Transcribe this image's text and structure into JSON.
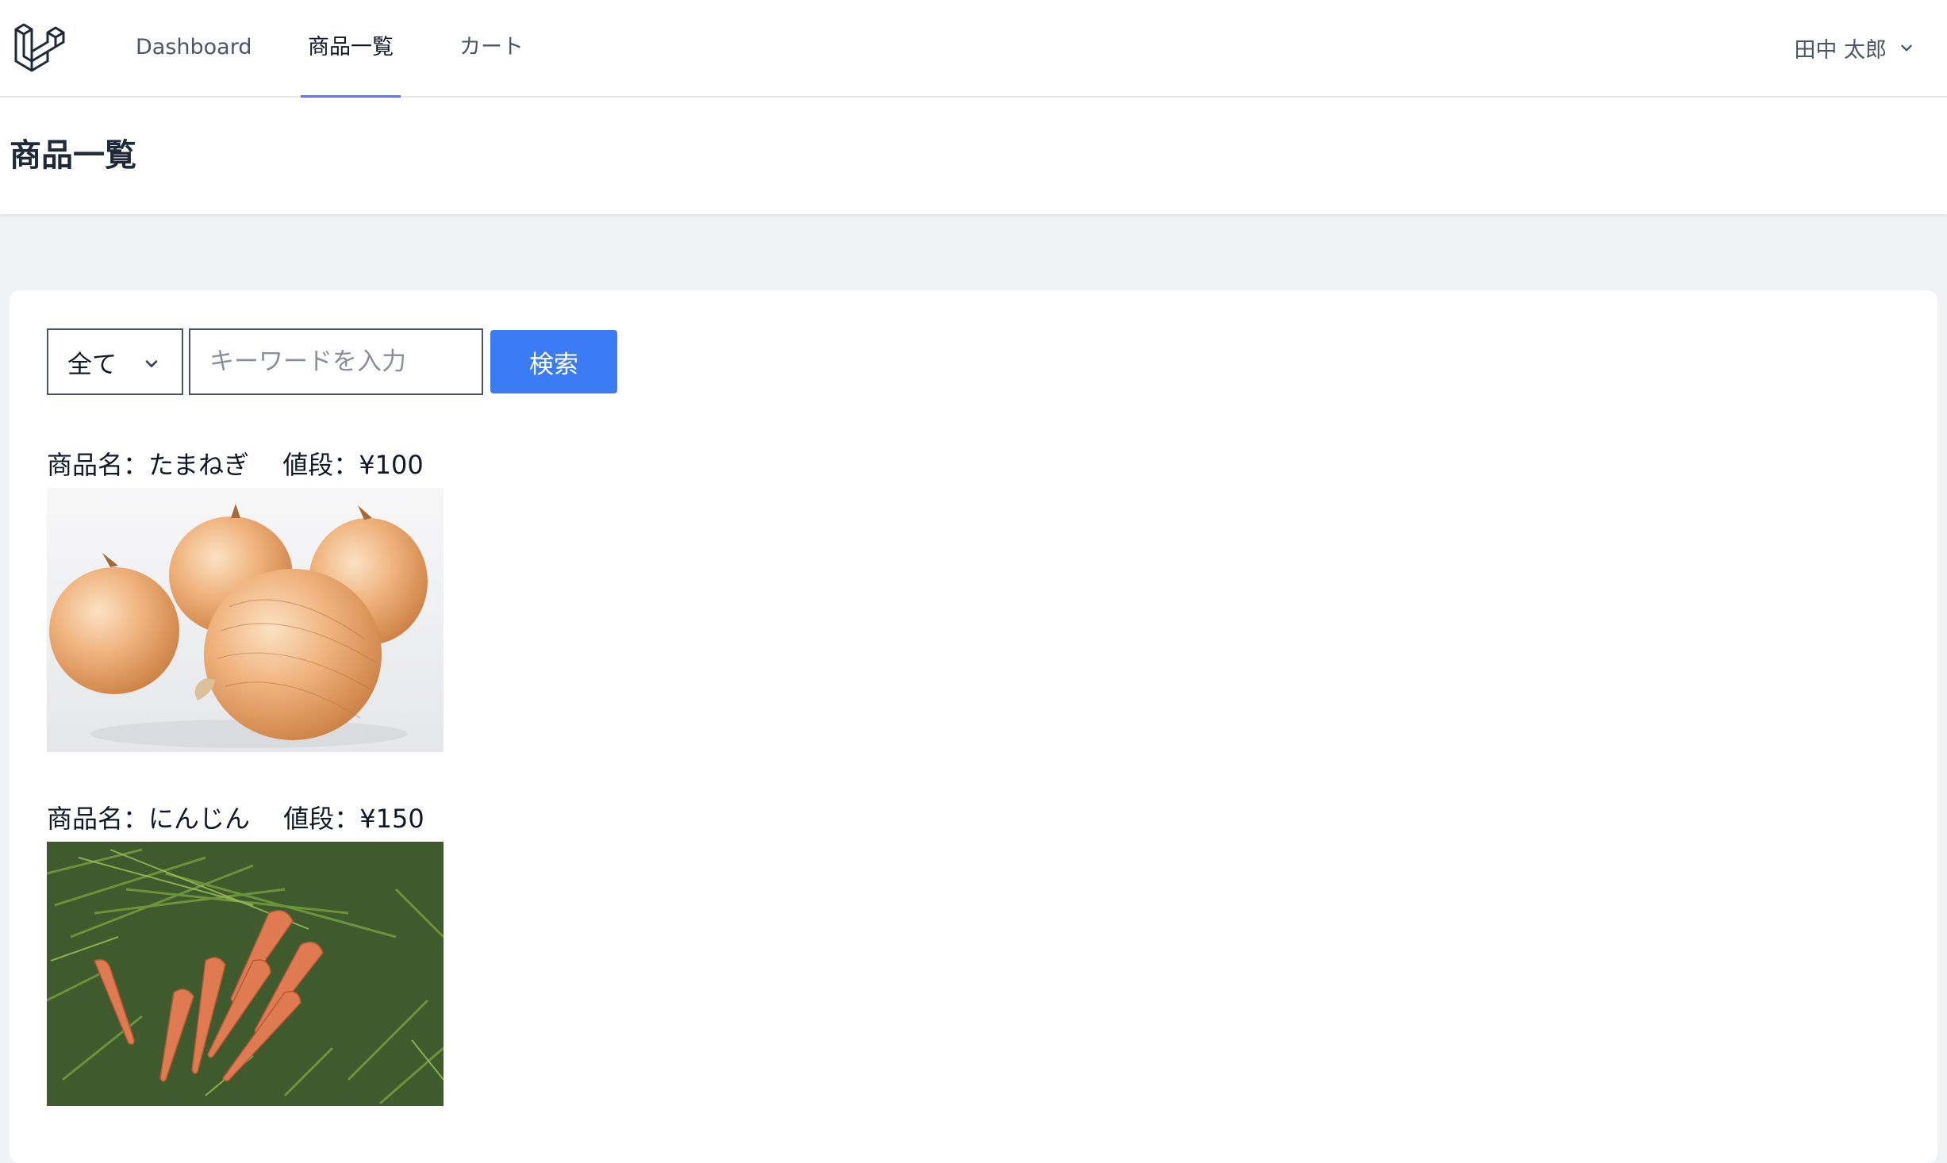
{
  "nav": {
    "logo_icon": "laravel-logo-icon",
    "links": [
      {
        "label": "Dashboard",
        "active": false
      },
      {
        "label": "商品一覧",
        "active": true
      },
      {
        "label": "カート",
        "active": false
      }
    ],
    "accent_color": "#6875e0",
    "user": {
      "name": "田中 太郎",
      "icon": "chevron-down-icon"
    }
  },
  "header": {
    "title": "商品一覧"
  },
  "search": {
    "category_selected": "全て",
    "keyword_placeholder": "キーワードを入力",
    "keyword_value": "",
    "button_label": "検索",
    "button_color": "#3b7cf5"
  },
  "products": [
    {
      "name_label": "商品名：",
      "name": "たまねぎ",
      "price_label": "値段：",
      "price": "¥100",
      "image_icon": "onion-photo"
    },
    {
      "name_label": "商品名：",
      "name": "にんじん",
      "price_label": "値段：",
      "price": "¥150",
      "image_icon": "carrot-photo"
    }
  ]
}
